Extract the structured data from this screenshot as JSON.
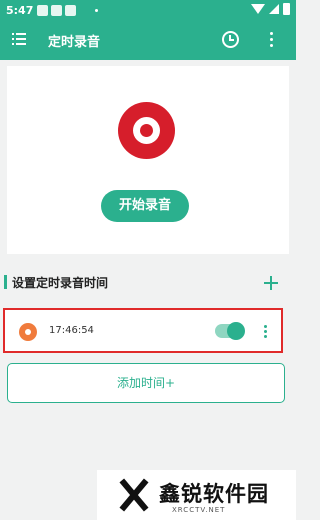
{
  "status_bar": {
    "time": "5:47"
  },
  "app_bar": {
    "title": "定时录音"
  },
  "record": {
    "button_label": "开始录音"
  },
  "schedule": {
    "section_title": "设置定时录音时间",
    "items": [
      {
        "time": "17:46:54",
        "enabled": true
      }
    ],
    "add_button_label": "添加时间+"
  },
  "watermark": {
    "name": "鑫锐软件园",
    "domain": "XRCCTV.NET"
  },
  "colors": {
    "accent": "#2bb08e",
    "record_red": "#d61e2b",
    "highlight_border": "#e02a2a"
  }
}
